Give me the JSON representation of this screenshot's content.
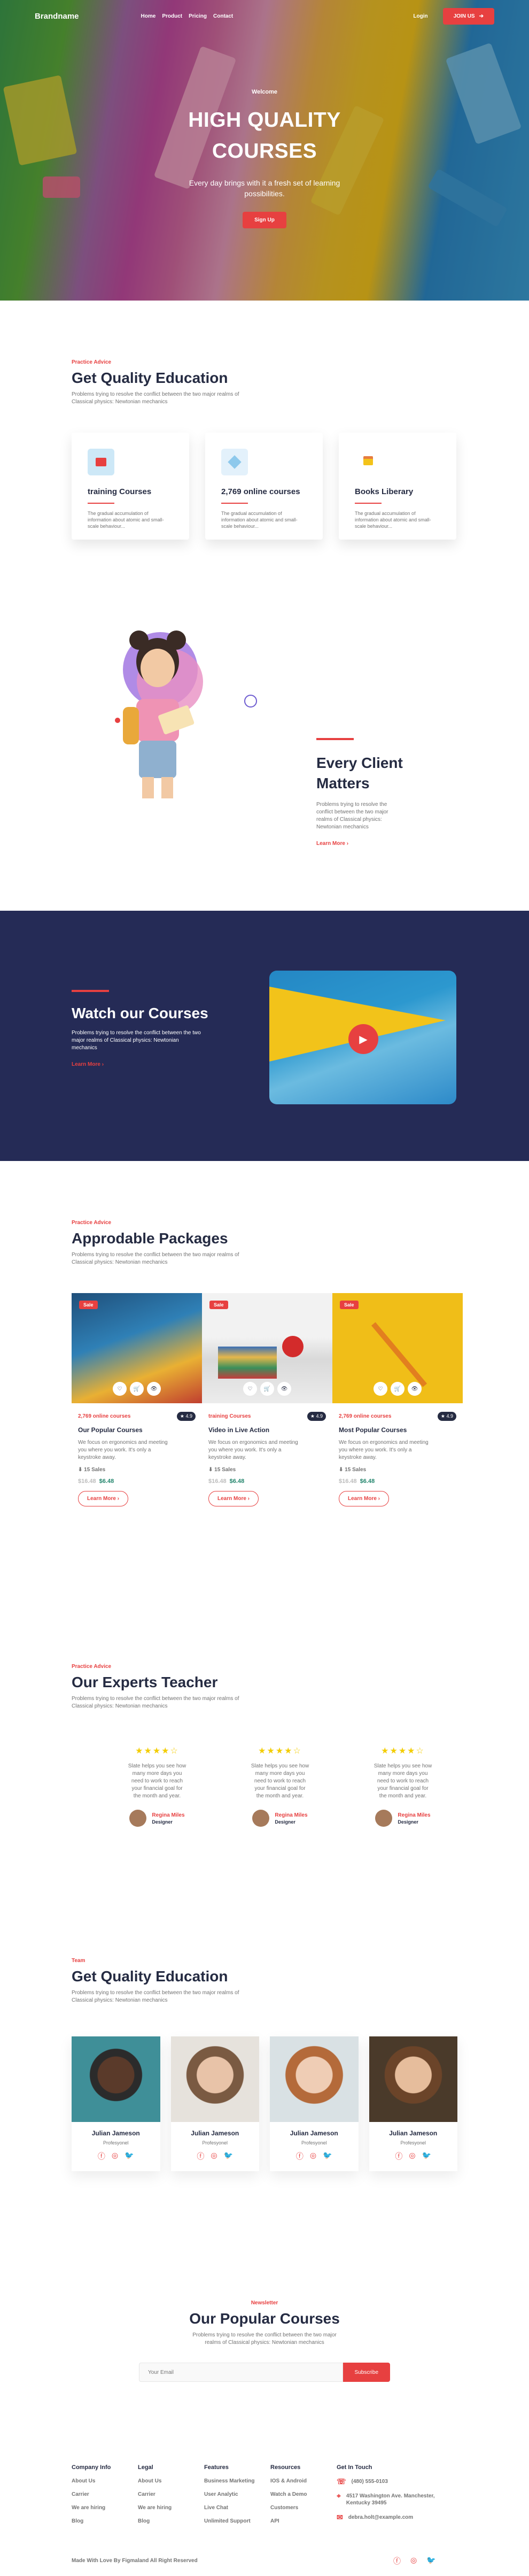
{
  "nav": {
    "brand": "Brandname",
    "menu": [
      "Home",
      "Product",
      "Pricing",
      "Contact"
    ],
    "login": "Login",
    "join": "JOIN US"
  },
  "hero": {
    "welcome": "Welcome",
    "title1": "HIGH QUALITY",
    "title2": "COURSES",
    "text": "Every day brings with it a fresh set of learning possibilities.",
    "button": "Sign Up"
  },
  "quality": {
    "tag": "Practice Advice",
    "title": "Get Quality Education",
    "text": "Problems trying to resolve the conflict between the two major realms of Classical physics: Newtonian mechanics",
    "cards": [
      {
        "title": "training Courses",
        "text": "The gradual accumulation of information about atomic and small-scale behaviour...",
        "icon": "monitor-icon"
      },
      {
        "title": "2,769 online courses",
        "text": "The gradual accumulation of information about atomic and small-scale behaviour...",
        "icon": "book-icon"
      },
      {
        "title": "Books Liberary",
        "text": "The gradual accumulation of information about atomic and small-scale behaviour...",
        "icon": "books-icon"
      }
    ]
  },
  "client": {
    "title1": "Every Client",
    "title2": "Matters",
    "text": "Problems trying to resolve the conflict between the two major realms of Classical physics: Newtonian mechanics",
    "link": "Learn More"
  },
  "watch": {
    "title": "Watch our Courses",
    "text": "Problems trying to resolve the conflict between the two major realms of Classical physics: Newtonian mechanics",
    "link": "Learn More"
  },
  "packages": {
    "tag": "Practice Advice",
    "title": "Approdable Packages",
    "text": "Problems trying to resolve the conflict between the two major realms of Classical physics: Newtonian mechanics",
    "items": [
      {
        "sale": "Sale",
        "category": "2,769 online courses",
        "rating": "4.9",
        "title": "Our Popular Courses",
        "text": "We focus on ergonomics and meeting you where you work. It's only a keystroke away.",
        "sales": "15 Sales",
        "old": "$16.48",
        "new": "$6.48",
        "button": "Learn More"
      },
      {
        "sale": "Sale",
        "category": "training Courses",
        "rating": "4.9",
        "title": "Video in Live Action",
        "text": "We focus on ergonomics and meeting you where you work. It's only a keystroke away.",
        "sales": "15 Sales",
        "old": "$16.48",
        "new": "$6.48",
        "button": "Learn More"
      },
      {
        "sale": "Sale",
        "category": "2,769 online courses",
        "rating": "4.9",
        "title": "Most Popular Courses",
        "text": "We focus on ergonomics and meeting you where you work. It's only a keystroke away.",
        "sales": "15 Sales",
        "old": "$16.48",
        "new": "$6.48",
        "button": "Learn More"
      }
    ]
  },
  "experts": {
    "tag": "Practice Advice",
    "title": "Our Experts Teacher",
    "text": "Problems trying to resolve the conflict between the two major realms of Classical physics: Newtonian mechanics",
    "items": [
      {
        "stars": "★★★★☆",
        "text": "Slate helps you see how many more days you need to work to reach your financial goal for the month and year.",
        "name": "Regina Miles",
        "role": "Designer"
      },
      {
        "stars": "★★★★☆",
        "text": "Slate helps you see how many more days you need to work to reach your financial goal for the month and year.",
        "name": "Regina Miles",
        "role": "Designer"
      },
      {
        "stars": "★★★★☆",
        "text": "Slate helps you see how many more days you need to work to reach your financial goal for the month and year.",
        "name": "Regina Miles",
        "role": "Designer"
      }
    ]
  },
  "team": {
    "tag": "Team",
    "title": "Get Quality Education",
    "text": "Problems trying to resolve the conflict between the two major realms of Classical physics: Newtonian mechanics",
    "members": [
      {
        "name": "Julian Jameson",
        "role": "Profesyonel"
      },
      {
        "name": "Julian Jameson",
        "role": "Profesyonel"
      },
      {
        "name": "Julian Jameson",
        "role": "Profesyonel"
      },
      {
        "name": "Julian Jameson",
        "role": "Profesyonel"
      }
    ]
  },
  "newsletter": {
    "tag": "Newsletter",
    "title": "Our Popular Courses",
    "text": "Problems trying to resolve the conflict between the two major realms of Classical physics: Newtonian mechanics",
    "placeholder": "Your Email",
    "button": "Subscribe"
  },
  "footer": {
    "cols": [
      {
        "title": "Company Info",
        "links": [
          "About Us",
          "Carrier",
          "We are hiring",
          "Blog"
        ]
      },
      {
        "title": "Legal",
        "links": [
          "About Us",
          "Carrier",
          "We are hiring",
          "Blog"
        ]
      },
      {
        "title": "Features",
        "links": [
          "Business Marketing",
          "User Analytic",
          "Live Chat",
          "Unlimited Support"
        ]
      },
      {
        "title": "Resources",
        "links": [
          "IOS & Android",
          "Watch a Demo",
          "Customers",
          "API"
        ]
      }
    ],
    "contact": {
      "title": "Get In Touch",
      "phone": "(480) 555-0103",
      "address": "4517 Washington Ave. Manchester, Kentucky 39495",
      "email": "debra.holt@example.com"
    },
    "copyright": "Made With Love By Figmaland All Right Reserved"
  }
}
